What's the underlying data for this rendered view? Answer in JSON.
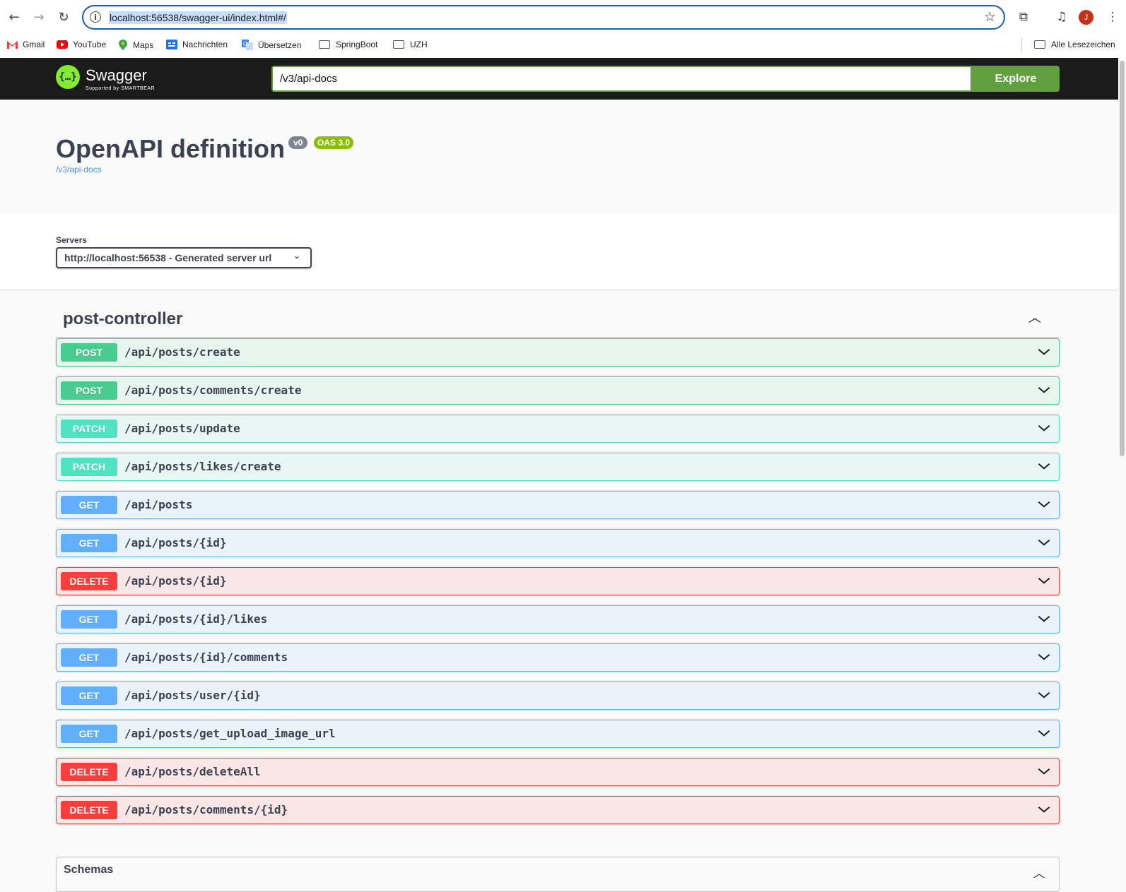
{
  "browser": {
    "url": "localhost:56538/swagger-ui/index.html#/",
    "avatar_initial": "J",
    "bookmarks": [
      {
        "label": "Gmail",
        "icon": "gmail-icon"
      },
      {
        "label": "YouTube",
        "icon": "youtube-icon"
      },
      {
        "label": "Maps",
        "icon": "maps-icon"
      },
      {
        "label": "Nachrichten",
        "icon": "news-icon"
      },
      {
        "label": "Übersetzen",
        "icon": "translate-icon"
      },
      {
        "label": "SpringBoot",
        "icon": "folder-icon"
      },
      {
        "label": "UZH",
        "icon": "folder-icon"
      }
    ],
    "all_bookmarks": "Alle Lesezeichen"
  },
  "topbar": {
    "logo_title": "Swagger",
    "logo_sub": "Supported by SMARTBEAR",
    "spec_url": "/v3/api-docs",
    "explore_label": "Explore"
  },
  "info": {
    "title": "OpenAPI definition",
    "version": "v0",
    "oas": "OAS 3.0",
    "link": "/v3/api-docs"
  },
  "servers": {
    "label": "Servers",
    "selected": "http://localhost:56538 - Generated server url"
  },
  "tag": {
    "name": "post-controller"
  },
  "operations": [
    {
      "method": "POST",
      "path": "/api/posts/create",
      "kind": "post"
    },
    {
      "method": "POST",
      "path": "/api/posts/comments/create",
      "kind": "post"
    },
    {
      "method": "PATCH",
      "path": "/api/posts/update",
      "kind": "patch"
    },
    {
      "method": "PATCH",
      "path": "/api/posts/likes/create",
      "kind": "patch"
    },
    {
      "method": "GET",
      "path": "/api/posts",
      "kind": "get"
    },
    {
      "method": "GET",
      "path": "/api/posts/{id}",
      "kind": "get"
    },
    {
      "method": "DELETE",
      "path": "/api/posts/{id}",
      "kind": "delete"
    },
    {
      "method": "GET",
      "path": "/api/posts/{id}/likes",
      "kind": "get"
    },
    {
      "method": "GET",
      "path": "/api/posts/{id}/comments",
      "kind": "get"
    },
    {
      "method": "GET",
      "path": "/api/posts/user/{id}",
      "kind": "get"
    },
    {
      "method": "GET",
      "path": "/api/posts/get_upload_image_url",
      "kind": "get"
    },
    {
      "method": "DELETE",
      "path": "/api/posts/deleteAll",
      "kind": "delete"
    },
    {
      "method": "DELETE",
      "path": "/api/posts/comments/{id}",
      "kind": "delete"
    }
  ],
  "schemas": {
    "title": "Schemas"
  },
  "colors": {
    "post": "#49cc90",
    "patch": "#50e3c2",
    "get": "#61affe",
    "delete": "#f93e3e",
    "topbar": "#1b1b1b",
    "explore": "#62a03f"
  }
}
